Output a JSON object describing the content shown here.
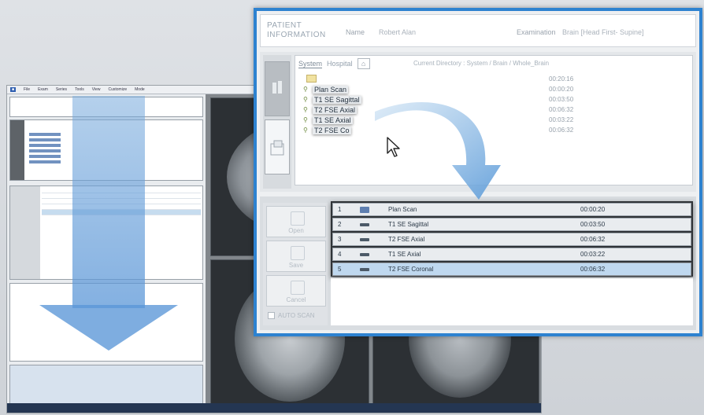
{
  "zoom": {
    "header": {
      "title_line1": "PATIENT",
      "title_line2": "INFORMATION",
      "name_label": "Name",
      "name_value": "Robert Alan",
      "exam_label": "Examination",
      "exam_value": "Brain [Head First- Supine]"
    },
    "browser": {
      "tabs": [
        "System",
        "Hospital"
      ],
      "home_glyph": "⌂",
      "current_directory": "Current Directory : System / Brain / Whole_Brain",
      "total_time": "00:20:16",
      "protocols": [
        {
          "name": "Plan Scan",
          "time": "00:00:20"
        },
        {
          "name": "T1 SE Sagittal",
          "time": "00:03:50"
        },
        {
          "name": "T2 FSE Axial",
          "time": "00:06:32"
        },
        {
          "name": "T1 SE Axial",
          "time": "00:03:22"
        },
        {
          "name": "T2 FSE Co",
          "time": "00:06:32"
        }
      ]
    },
    "actions": {
      "open": "Open",
      "save": "Save",
      "cancel": "Cancel",
      "auto_scan": "AUTO SCAN"
    },
    "queue": [
      {
        "num": "1",
        "name": "Plan Scan",
        "time": "00:00:20"
      },
      {
        "num": "2",
        "name": "T1 SE Sagittal",
        "time": "00:03:50"
      },
      {
        "num": "3",
        "name": "T2 FSE Axial",
        "time": "00:06:32"
      },
      {
        "num": "4",
        "name": "T1 SE Axial",
        "time": "00:03:22"
      },
      {
        "num": "5",
        "name": "T2 FSE Coronal",
        "time": "00:06:32"
      }
    ]
  },
  "background_window": {
    "menu": [
      "File",
      "Exam",
      "Series",
      "Tools",
      "View",
      "Customize",
      "Mode"
    ]
  },
  "colors": {
    "zoom_border": "#2d82d0",
    "arrow": "#5a96d7",
    "selected_row": "#bfd8ef"
  }
}
